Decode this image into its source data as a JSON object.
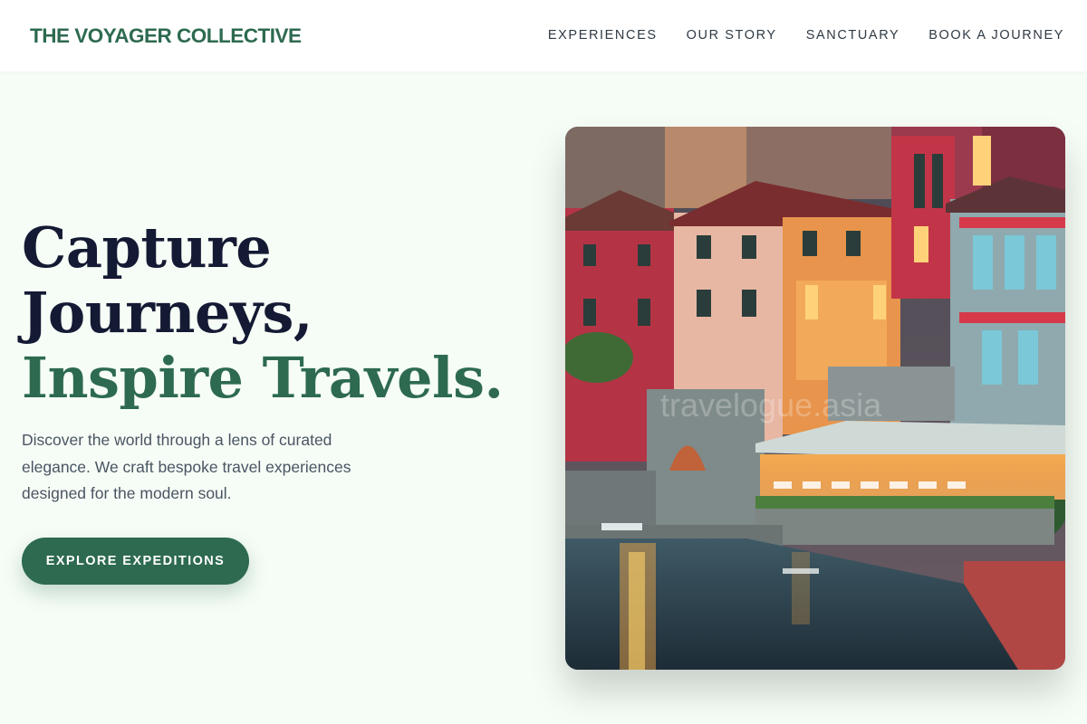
{
  "brand": {
    "name": "THE VOYAGER COLLECTIVE"
  },
  "nav": {
    "items": [
      {
        "label": "EXPERIENCES"
      },
      {
        "label": "OUR STORY"
      },
      {
        "label": "SANCTUARY"
      },
      {
        "label": "BOOK A JOURNEY"
      }
    ]
  },
  "hero": {
    "headline_line1": "Capture",
    "headline_line2": "Journeys,",
    "headline_accent": "Inspire Travels.",
    "description": "Discover the world through a lens of curated elegance. We craft bespoke travel experiences designed for the modern soul.",
    "cta_label": "EXPLORE EXPEDITIONS",
    "image_watermark": "travelogue.asia"
  },
  "colors": {
    "accent": "#2d6a4f",
    "headline": "#141a33",
    "background": "#f6fdf6"
  }
}
